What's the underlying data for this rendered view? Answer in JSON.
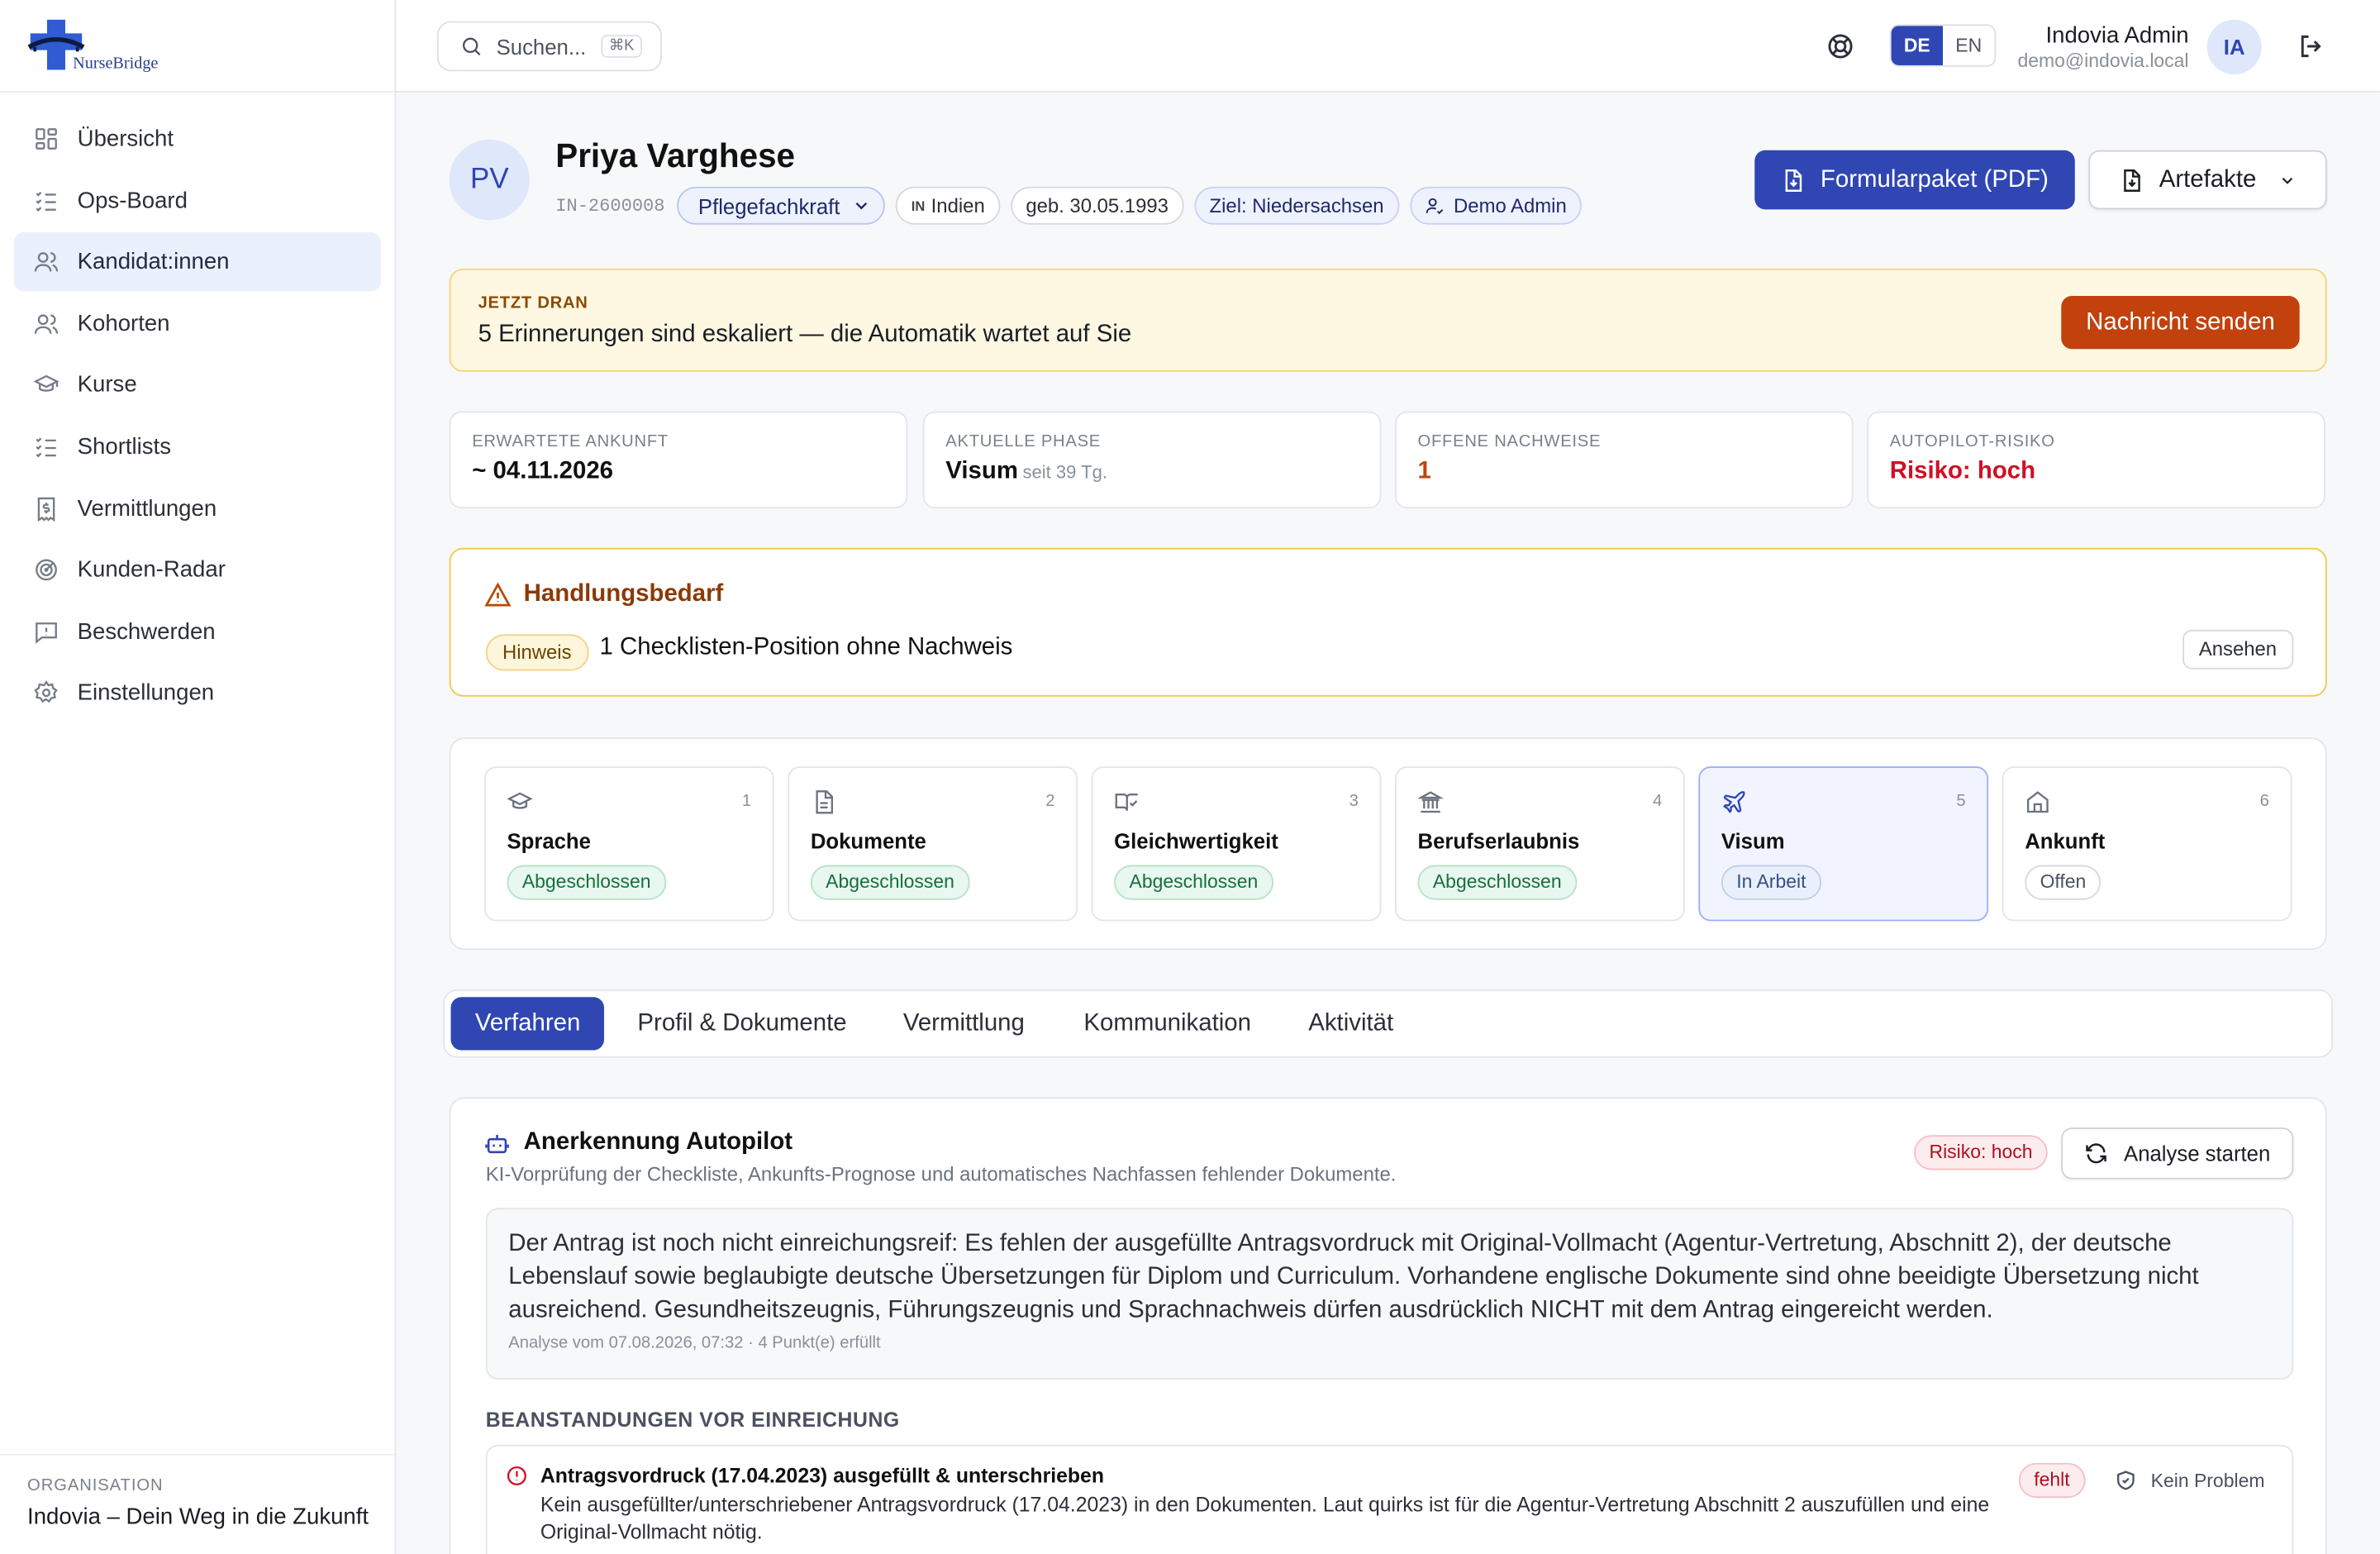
{
  "brand": {
    "logo_text": "NurseBridge"
  },
  "sidebar": {
    "items": [
      {
        "label": "Übersicht",
        "icon": "grid-icon"
      },
      {
        "label": "Ops-Board",
        "icon": "list-check-icon"
      },
      {
        "label": "Kandidat:innen",
        "icon": "users-icon",
        "active": true
      },
      {
        "label": "Kohorten",
        "icon": "users-icon"
      },
      {
        "label": "Kurse",
        "icon": "graduation-cap-icon"
      },
      {
        "label": "Shortlists",
        "icon": "list-check-icon"
      },
      {
        "label": "Vermittlungen",
        "icon": "receipt-icon"
      },
      {
        "label": "Kunden-Radar",
        "icon": "radar-icon"
      },
      {
        "label": "Beschwerden",
        "icon": "message-alert-icon"
      },
      {
        "label": "Einstellungen",
        "icon": "gear-icon"
      }
    ],
    "org_label": "ORGANISATION",
    "org_name": "Indovia – Dein Weg in die Zukunft"
  },
  "topbar": {
    "search_placeholder": "Suchen...",
    "search_shortcut": "⌘K",
    "lang_active": "DE",
    "lang_other": "EN",
    "user_name": "Indovia Admin",
    "user_email": "demo@indovia.local",
    "user_initials": "IA"
  },
  "candidate": {
    "initials": "PV",
    "name": "Priya Varghese",
    "id": "IN-2600008",
    "role": "Pflegefachkraft",
    "country_code": "IN",
    "country": "Indien",
    "birth": "geb. 30.05.1993",
    "target": "Ziel: Niedersachsen",
    "owner": "Demo Admin"
  },
  "actions": {
    "pdf_button": "Formularpaket (PDF)",
    "artifacts_button": "Artefakte"
  },
  "now_alert": {
    "label": "JETZT DRAN",
    "text": "5 Erinnerungen sind eskaliert — die Automatik wartet auf Sie",
    "button": "Nachricht senden"
  },
  "stats": [
    {
      "label": "ERWARTETE ANKUNFT",
      "value": "~ 04.11.2026",
      "sub": ""
    },
    {
      "label": "AKTUELLE PHASE",
      "value": "Visum",
      "sub": "seit 39 Tg."
    },
    {
      "label": "OFFENE NACHWEISE",
      "value": "1",
      "sub": ""
    },
    {
      "label": "AUTOPILOT-RISIKO",
      "value": "Risiko: hoch",
      "sub": ""
    }
  ],
  "action_needed": {
    "title": "Handlungsbedarf",
    "chip": "Hinweis",
    "text": "1 Checklisten-Position ohne Nachweis",
    "button": "Ansehen"
  },
  "phases": [
    {
      "num": "1",
      "name": "Sprache",
      "status": "Abgeschlossen",
      "icon": "graduation-cap-icon"
    },
    {
      "num": "2",
      "name": "Dokumente",
      "status": "Abgeschlossen",
      "icon": "document-icon"
    },
    {
      "num": "3",
      "name": "Gleichwertigkeit",
      "status": "Abgeschlossen",
      "icon": "book-check-icon"
    },
    {
      "num": "4",
      "name": "Berufserlaubnis",
      "status": "Abgeschlossen",
      "icon": "landmark-icon"
    },
    {
      "num": "5",
      "name": "Visum",
      "status": "In Arbeit",
      "icon": "plane-icon"
    },
    {
      "num": "6",
      "name": "Ankunft",
      "status": "Offen",
      "icon": "home-icon"
    }
  ],
  "tabs": [
    "Verfahren",
    "Profil & Dokumente",
    "Vermittlung",
    "Kommunikation",
    "Aktivität"
  ],
  "autopilot": {
    "title": "Anerkennung Autopilot",
    "subtitle": "KI-Vorprüfung der Checkliste, Ankunfts-Prognose und automatisches Nachfassen fehlender Dokumente.",
    "risk_chip": "Risiko: hoch",
    "analyse_button": "Analyse starten",
    "summary": "Der Antrag ist noch nicht einreichungsreif: Es fehlen der ausgefüllte Antragsvordruck mit Original-Vollmacht (Agentur-Vertretung, Abschnitt 2), der deutsche Lebenslauf sowie beglaubigte deutsche Übersetzungen für Diplom und Curriculum. Vorhandene englische Dokumente sind ohne beeidigte Übersetzung nicht ausreichend. Gesundheitszeugnis, Führungszeugnis und Sprachnachweis dürfen ausdrücklich NICHT mit dem Antrag eingereicht werden.",
    "summary_meta": "Analyse vom 07.08.2026, 07:32 · 4 Punkt(e) erfüllt",
    "issues_label": "BEANSTANDUNGEN VOR EINREICHUNG",
    "issue": {
      "title": "Antragsvordruck (17.04.2023) ausgefüllt & unterschrieben",
      "text": "Kein ausgefüllter/unterschriebener Antragsvordruck (17.04.2023) in den Dokumenten. Laut quirks ist für die Agentur-Vertretung Abschnitt 2 auszufüllen und eine Original-Vollmacht nötig.",
      "status": "fehlt",
      "dismiss": "Kein Problem"
    }
  },
  "colors": {
    "primary": "#2f46b3",
    "warning": "#c2410c",
    "danger": "#d10f23",
    "success": "#15703d"
  }
}
